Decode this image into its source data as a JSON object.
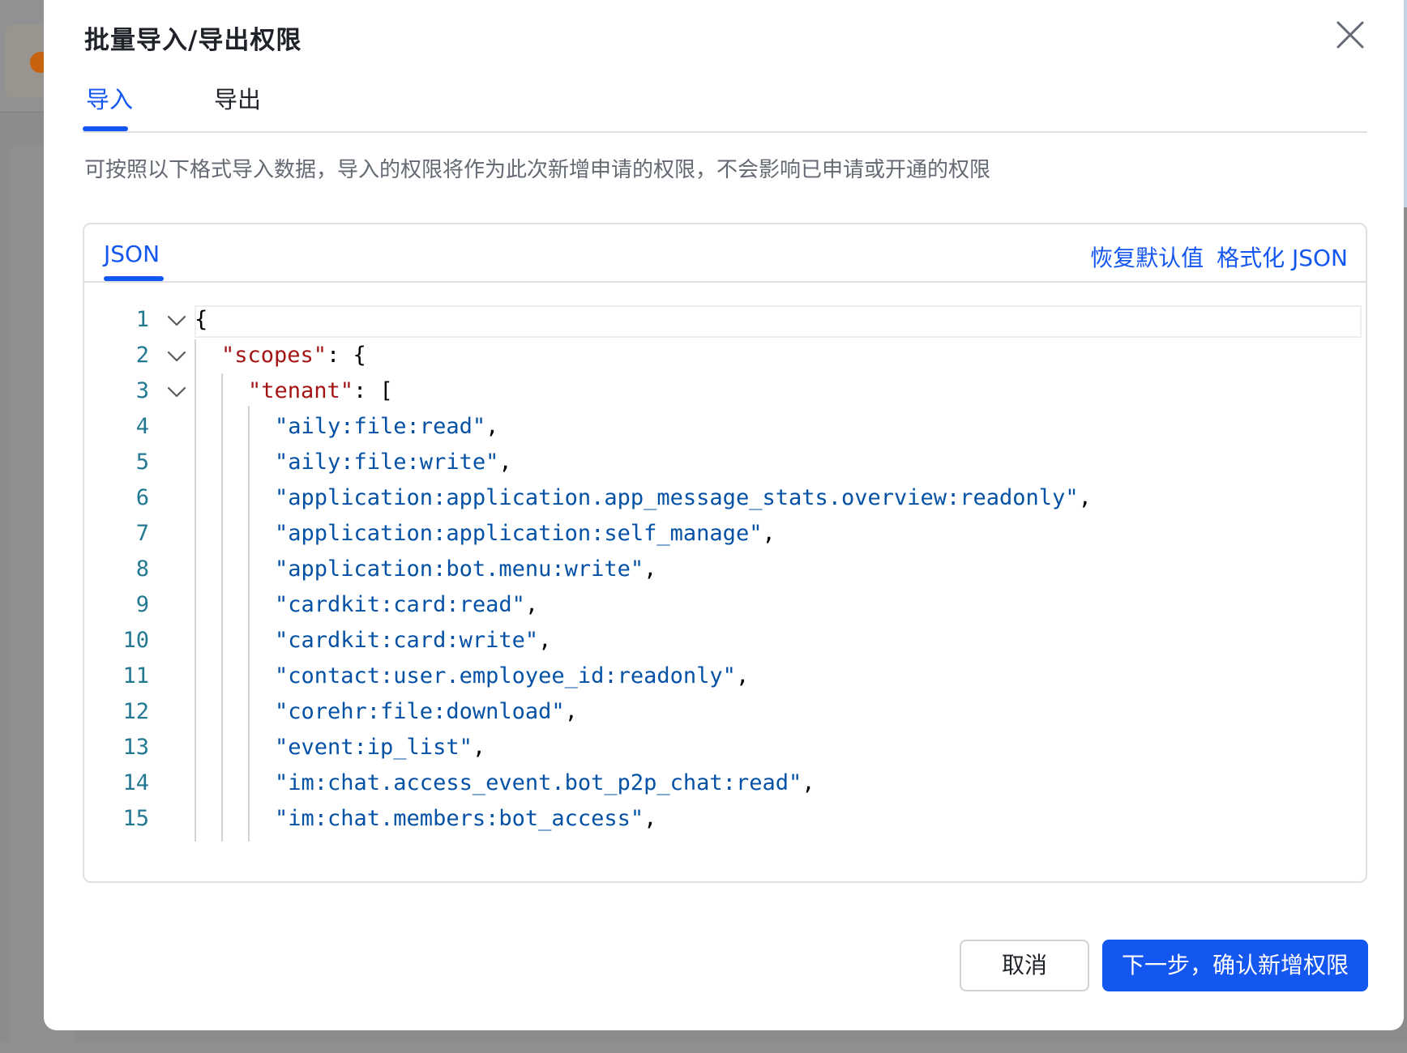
{
  "dialog": {
    "title": "批量导入/导出权限",
    "close_icon": "close-icon"
  },
  "tabs": [
    {
      "label": "导入",
      "active": true
    },
    {
      "label": "导出",
      "active": false
    }
  ],
  "description": "可按照以下格式导入数据，导入的权限将作为此次新增申请的权限，不会影响已申请或开通的权限",
  "editor": {
    "tab_label": "JSON",
    "restore_default_label": "恢复默认值",
    "format_json_label": "格式化 JSON",
    "lines": [
      {
        "number": "1",
        "foldable": true,
        "parts": [
          {
            "t": "{",
            "c": "punct"
          }
        ]
      },
      {
        "number": "2",
        "foldable": true,
        "parts": [
          {
            "t": "\"scopes\"",
            "c": "key"
          },
          {
            "t": ": {",
            "c": "punct"
          }
        ]
      },
      {
        "number": "3",
        "foldable": true,
        "parts": [
          {
            "t": "\"tenant\"",
            "c": "key"
          },
          {
            "t": ": [",
            "c": "punct"
          }
        ]
      },
      {
        "number": "4",
        "foldable": false,
        "parts": [
          {
            "t": "\"aily:file:read\"",
            "c": "str"
          },
          {
            "t": ",",
            "c": "punct"
          }
        ]
      },
      {
        "number": "5",
        "foldable": false,
        "parts": [
          {
            "t": "\"aily:file:write\"",
            "c": "str"
          },
          {
            "t": ",",
            "c": "punct"
          }
        ]
      },
      {
        "number": "6",
        "foldable": false,
        "parts": [
          {
            "t": "\"application:application.app_message_stats.overview:readonly\"",
            "c": "str"
          },
          {
            "t": ",",
            "c": "punct"
          }
        ]
      },
      {
        "number": "7",
        "foldable": false,
        "parts": [
          {
            "t": "\"application:application:self_manage\"",
            "c": "str"
          },
          {
            "t": ",",
            "c": "punct"
          }
        ]
      },
      {
        "number": "8",
        "foldable": false,
        "parts": [
          {
            "t": "\"application:bot.menu:write\"",
            "c": "str"
          },
          {
            "t": ",",
            "c": "punct"
          }
        ]
      },
      {
        "number": "9",
        "foldable": false,
        "parts": [
          {
            "t": "\"cardkit:card:read\"",
            "c": "str"
          },
          {
            "t": ",",
            "c": "punct"
          }
        ]
      },
      {
        "number": "10",
        "foldable": false,
        "parts": [
          {
            "t": "\"cardkit:card:write\"",
            "c": "str"
          },
          {
            "t": ",",
            "c": "punct"
          }
        ]
      },
      {
        "number": "11",
        "foldable": false,
        "parts": [
          {
            "t": "\"contact:user.employee_id:readonly\"",
            "c": "str"
          },
          {
            "t": ",",
            "c": "punct"
          }
        ]
      },
      {
        "number": "12",
        "foldable": false,
        "parts": [
          {
            "t": "\"corehr:file:download\"",
            "c": "str"
          },
          {
            "t": ",",
            "c": "punct"
          }
        ]
      },
      {
        "number": "13",
        "foldable": false,
        "parts": [
          {
            "t": "\"event:ip_list\"",
            "c": "str"
          },
          {
            "t": ",",
            "c": "punct"
          }
        ]
      },
      {
        "number": "14",
        "foldable": false,
        "parts": [
          {
            "t": "\"im:chat.access_event.bot_p2p_chat:read\"",
            "c": "str"
          },
          {
            "t": ",",
            "c": "punct"
          }
        ]
      },
      {
        "number": "15",
        "foldable": false,
        "parts": [
          {
            "t": "\"im:chat.members:bot_access\"",
            "c": "str"
          },
          {
            "t": ",",
            "c": "punct"
          }
        ]
      }
    ]
  },
  "footer": {
    "cancel_label": "取消",
    "confirm_label": "下一步，确认新增权限"
  },
  "colors": {
    "accent": "#1456f0",
    "key": "#a31515",
    "string": "#0451a5",
    "line_number": "#237893"
  }
}
